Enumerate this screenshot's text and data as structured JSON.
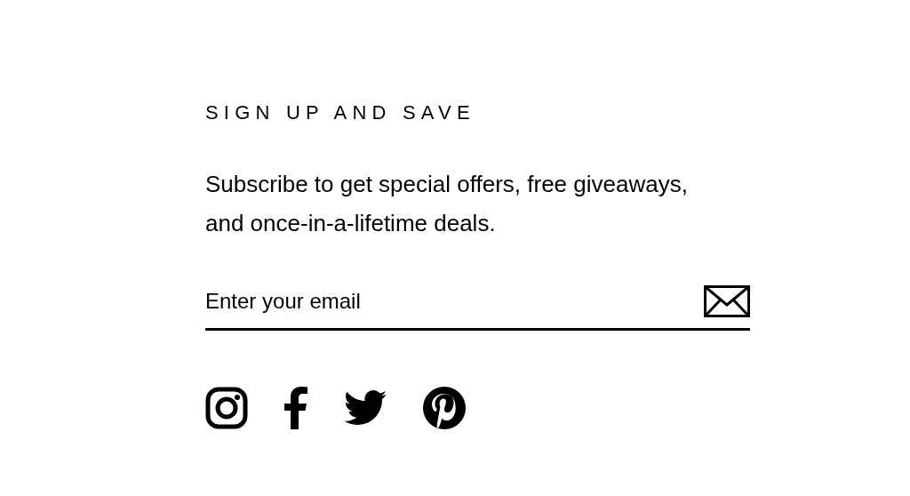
{
  "newsletter": {
    "heading": "SIGN UP AND SAVE",
    "description": "Subscribe to get special offers, free giveaways, and once-in-a-lifetime deals.",
    "email": {
      "placeholder": "Enter your email"
    }
  }
}
